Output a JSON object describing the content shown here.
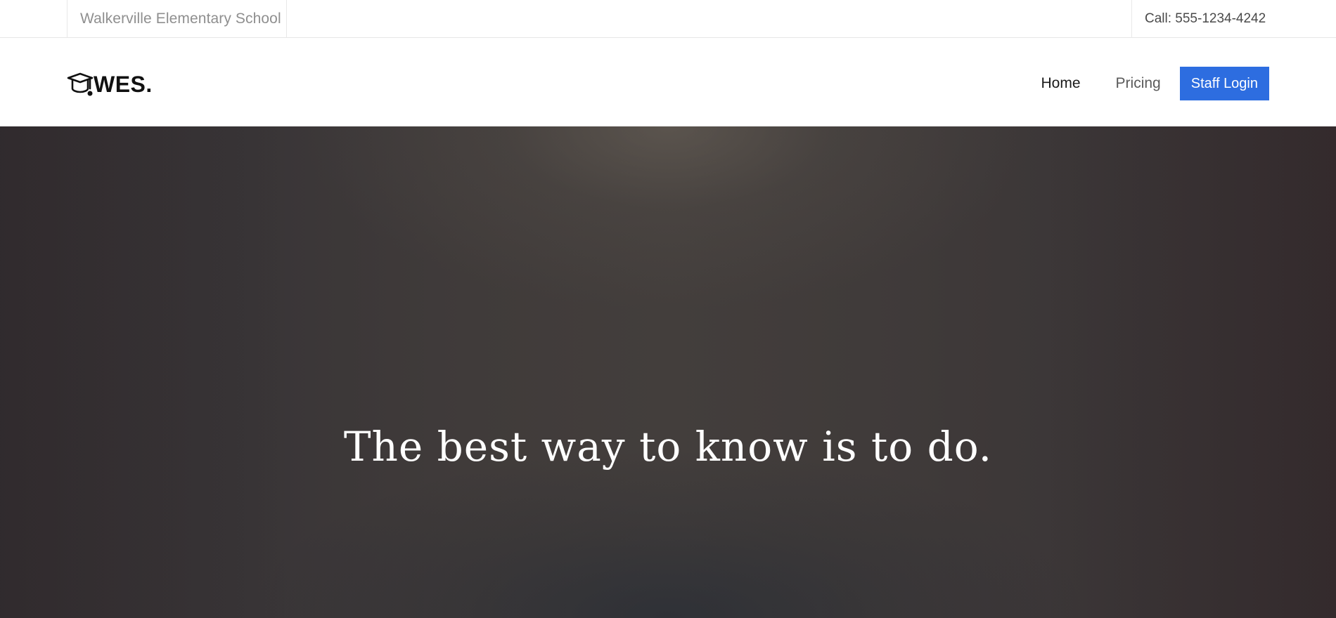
{
  "topbar": {
    "school_name": "Walkerville Elementary School",
    "phone": "Call: 555-1234-4242"
  },
  "navbar": {
    "brand": "WES.",
    "logo_icon": "graduation-cap-icon",
    "links": [
      {
        "label": "Home",
        "active": true
      },
      {
        "label": "Pricing",
        "active": false
      }
    ],
    "login_label": "Staff Login",
    "accent_color": "#2d6de0"
  },
  "hero": {
    "headline": "The best way to know is to do."
  }
}
